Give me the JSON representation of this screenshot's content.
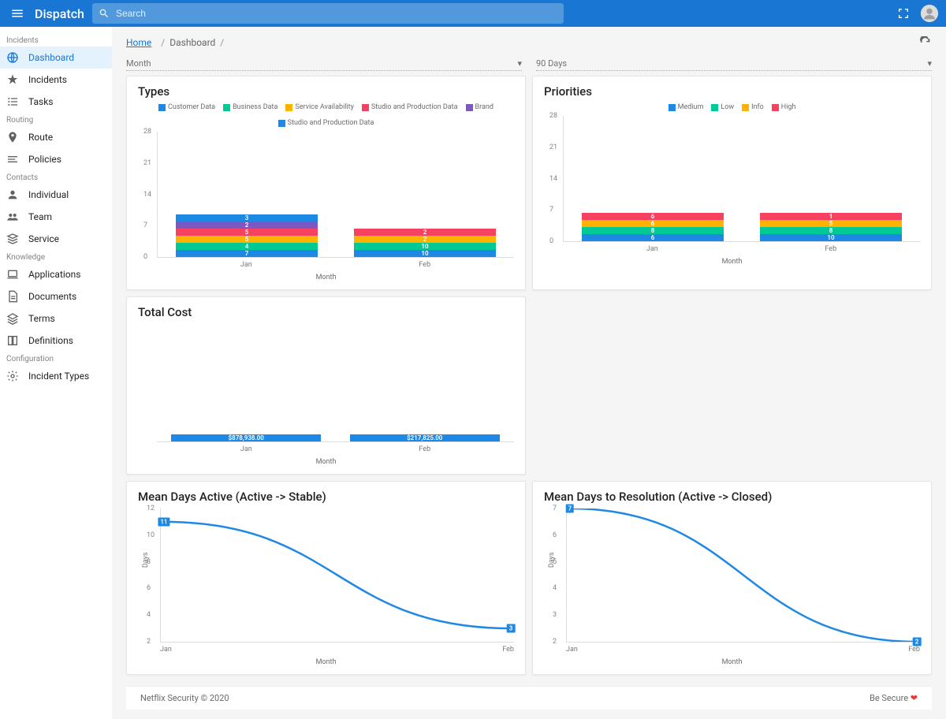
{
  "topbar": {
    "brand": "Dispatch",
    "search_placeholder": "Search"
  },
  "breadcrumb": {
    "home": "Home",
    "current": "Dashboard"
  },
  "filters": {
    "period_label": "Month",
    "range_label": "90 Days"
  },
  "sidebar": {
    "sections": [
      {
        "label": "Incidents",
        "items": [
          {
            "icon": "globe",
            "label": "Dashboard",
            "active": true
          },
          {
            "icon": "star",
            "label": "Incidents"
          },
          {
            "icon": "checklist",
            "label": "Tasks"
          }
        ]
      },
      {
        "label": "Routing",
        "items": [
          {
            "icon": "pin",
            "label": "Route"
          },
          {
            "icon": "policies",
            "label": "Policies"
          }
        ]
      },
      {
        "label": "Contacts",
        "items": [
          {
            "icon": "person",
            "label": "Individual"
          },
          {
            "icon": "group",
            "label": "Team"
          },
          {
            "icon": "service",
            "label": "Service"
          }
        ]
      },
      {
        "label": "Knowledge",
        "items": [
          {
            "icon": "laptop",
            "label": "Applications"
          },
          {
            "icon": "doc",
            "label": "Documents"
          },
          {
            "icon": "layers",
            "label": "Terms"
          },
          {
            "icon": "book",
            "label": "Definitions"
          }
        ]
      },
      {
        "label": "Configuration",
        "items": [
          {
            "icon": "gear",
            "label": "Incident Types"
          }
        ]
      }
    ]
  },
  "colors": {
    "blue": "#1e88e5",
    "green": "#00c996",
    "orange": "#ffb300",
    "red": "#f64260",
    "purple": "#7e57c2",
    "blue2": "#1e88e5"
  },
  "chart_data": [
    {
      "id": "types",
      "type": "bar",
      "stacked": true,
      "title": "Types",
      "xlabel": "Month",
      "ylabel": "",
      "ylim": [
        0,
        28
      ],
      "yticks": [
        0,
        7,
        14,
        21,
        28
      ],
      "categories": [
        "Jan",
        "Feb"
      ],
      "series": [
        {
          "name": "Customer Data",
          "color": "#1e88e5",
          "values": [
            7,
            10
          ]
        },
        {
          "name": "Business Data",
          "color": "#00c996",
          "values": [
            4,
            10
          ]
        },
        {
          "name": "Service Availability",
          "color": "#ffb300",
          "values": [
            5,
            2
          ]
        },
        {
          "name": "Studio and Production Data",
          "color": "#f64260",
          "values": [
            5,
            2
          ]
        },
        {
          "name": "Brand",
          "color": "#7e57c2",
          "values": [
            2,
            0
          ]
        },
        {
          "name": "Studio and Production Data",
          "color": "#1e88e5",
          "values": [
            3,
            0
          ]
        }
      ]
    },
    {
      "id": "priorities",
      "type": "bar",
      "stacked": true,
      "title": "Priorities",
      "xlabel": "Month",
      "ylabel": "",
      "ylim": [
        0,
        28
      ],
      "yticks": [
        0,
        7,
        14,
        21,
        28
      ],
      "categories": [
        "Jan",
        "Feb"
      ],
      "series": [
        {
          "name": "Medium",
          "color": "#1e88e5",
          "values": [
            6,
            10
          ]
        },
        {
          "name": "Low",
          "color": "#00c996",
          "values": [
            8,
            8
          ]
        },
        {
          "name": "Info",
          "color": "#ffb300",
          "values": [
            6,
            5
          ]
        },
        {
          "name": "High",
          "color": "#f64260",
          "values": [
            6,
            1
          ]
        }
      ]
    },
    {
      "id": "cost",
      "type": "bar",
      "stacked": false,
      "title": "Total Cost",
      "xlabel": "Month",
      "ylabel": "",
      "ylim": [
        0,
        900000
      ],
      "categories": [
        "Jan",
        "Feb"
      ],
      "series": [
        {
          "name": "Cost",
          "color": "#1e88e5",
          "values": [
            878938.0,
            217825.0
          ],
          "labels": [
            "$878,938.00",
            "$217,825.00"
          ]
        }
      ]
    },
    {
      "id": "active",
      "type": "line",
      "title": "Mean Days Active (Active -> Stable)",
      "xlabel": "Month",
      "ylabel": "Days",
      "ylim": [
        2,
        12
      ],
      "yticks": [
        2,
        4,
        6,
        8,
        10,
        12
      ],
      "categories": [
        "Jan",
        "Feb"
      ],
      "values": [
        11,
        3
      ]
    },
    {
      "id": "resolution",
      "type": "line",
      "title": "Mean Days to Resolution (Active -> Closed)",
      "xlabel": "Month",
      "ylabel": "Days",
      "ylim": [
        2,
        7
      ],
      "yticks": [
        2.0,
        3.0,
        4.0,
        5.0,
        6.0,
        7.0
      ],
      "categories": [
        "Jan",
        "Feb"
      ],
      "values": [
        7,
        2
      ]
    }
  ],
  "footer": {
    "left": "Netflix Security © 2020",
    "right": "Be Secure"
  }
}
